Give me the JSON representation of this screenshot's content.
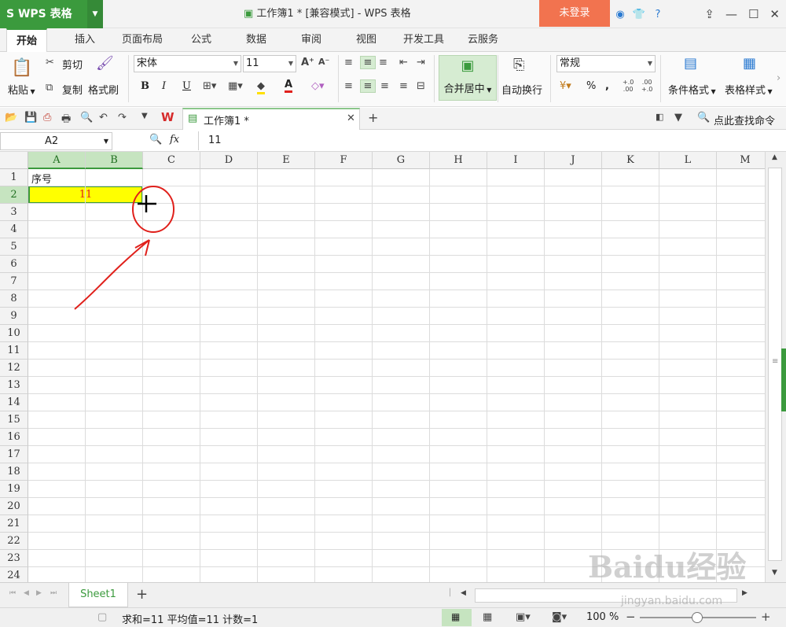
{
  "app": {
    "name": "WPS 表格",
    "window_title": "工作簿1 * [兼容模式] - WPS 表格",
    "login_label": "未登录"
  },
  "tabs": [
    "开始",
    "插入",
    "页面布局",
    "公式",
    "数据",
    "审阅",
    "视图",
    "开发工具",
    "云服务"
  ],
  "ribbon": {
    "paste": "粘贴",
    "cut": "剪切",
    "copy": "复制",
    "format_painter": "格式刷",
    "font_name": "宋体",
    "font_size": "11",
    "bold": "B",
    "italic": "I",
    "underline": "U",
    "font_color": "A",
    "merge_center": "合并居中",
    "wrap_text": "自动换行",
    "number_format": "常规",
    "percent": "%",
    "comma": ",",
    "conditional_format": "条件格式",
    "table_style": "表格样式"
  },
  "quickbar": {
    "doc_tab": "工作簿1 *",
    "search": "点此查找命令"
  },
  "formula_bar": {
    "name_box": "A2",
    "fx": "fx",
    "value": "11"
  },
  "columns": [
    "A",
    "B",
    "C",
    "D",
    "E",
    "F",
    "G",
    "H",
    "I",
    "J",
    "K",
    "L",
    "M"
  ],
  "rows": [
    "1",
    "2",
    "3",
    "4",
    "5",
    "6",
    "7",
    "8",
    "9",
    "10",
    "11",
    "12",
    "13",
    "14",
    "15",
    "16",
    "17",
    "18",
    "19",
    "20",
    "21",
    "22",
    "23",
    "24"
  ],
  "cells": {
    "A1": "序号",
    "A2": "11"
  },
  "colors": {
    "accent": "#3b9a3d",
    "selected_fill": "#ffff00",
    "cell_text_red": "#e0201b",
    "annotation": "#e0201b"
  },
  "sheet": {
    "name": "Sheet1",
    "add": "+"
  },
  "status": {
    "summary": "求和=11  平均值=11  计数=1",
    "zoom": "100 %"
  },
  "watermark": {
    "text": "Baidu经验",
    "url": "jingyan.baidu.com"
  }
}
